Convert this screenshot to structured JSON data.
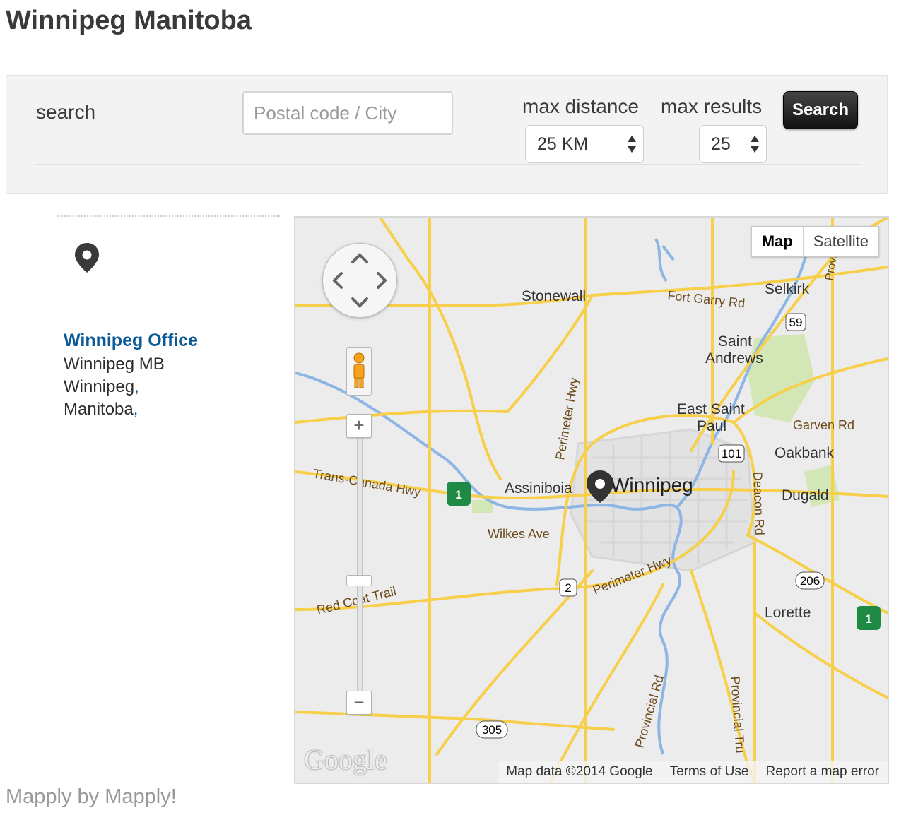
{
  "page": {
    "title": "Winnipeg Manitoba"
  },
  "search": {
    "label": "search",
    "input_placeholder": "Postal code / City",
    "input_value": "",
    "distance_label": "max distance",
    "distance_value": "25 KM",
    "results_label": "max results",
    "results_value": "25",
    "button_label": "Search"
  },
  "results": [
    {
      "name": "Winnipeg Office",
      "line1": "Winnipeg MB",
      "city": "Winnipeg",
      "province": "Manitoba"
    }
  ],
  "map": {
    "type_buttons": [
      "Map",
      "Satellite"
    ],
    "active_type": "Map",
    "places": [
      "Stonewall",
      "Fort Garry Rd",
      "Selkirk",
      "Saint",
      "Andrews",
      "East Saint",
      "Paul",
      "Garven Rd",
      "Oakbank",
      "Winnipeg",
      "Assiniboia",
      "Dugald",
      "Trans-Canada Hwy",
      "Wilkes Ave",
      "Perimeter Hwy",
      "Perimeter Hwy",
      "Deacon Rd",
      "Red Coat Trail",
      "Lorette",
      "Provincial Rd",
      "Provincial Tru",
      "Provi"
    ],
    "shields": [
      "59",
      "101",
      "2",
      "206",
      "305",
      "1",
      "1"
    ],
    "logo": "Google",
    "attribution": {
      "data": "Map data ©2014 Google",
      "terms": "Terms of Use",
      "report": "Report a map error"
    },
    "colors": {
      "road": "#f7cf4a",
      "water": "#8db6e4",
      "park": "#cfe5b0",
      "land": "#ececec"
    }
  },
  "footer": {
    "text": "Mapply by Mapply!"
  }
}
